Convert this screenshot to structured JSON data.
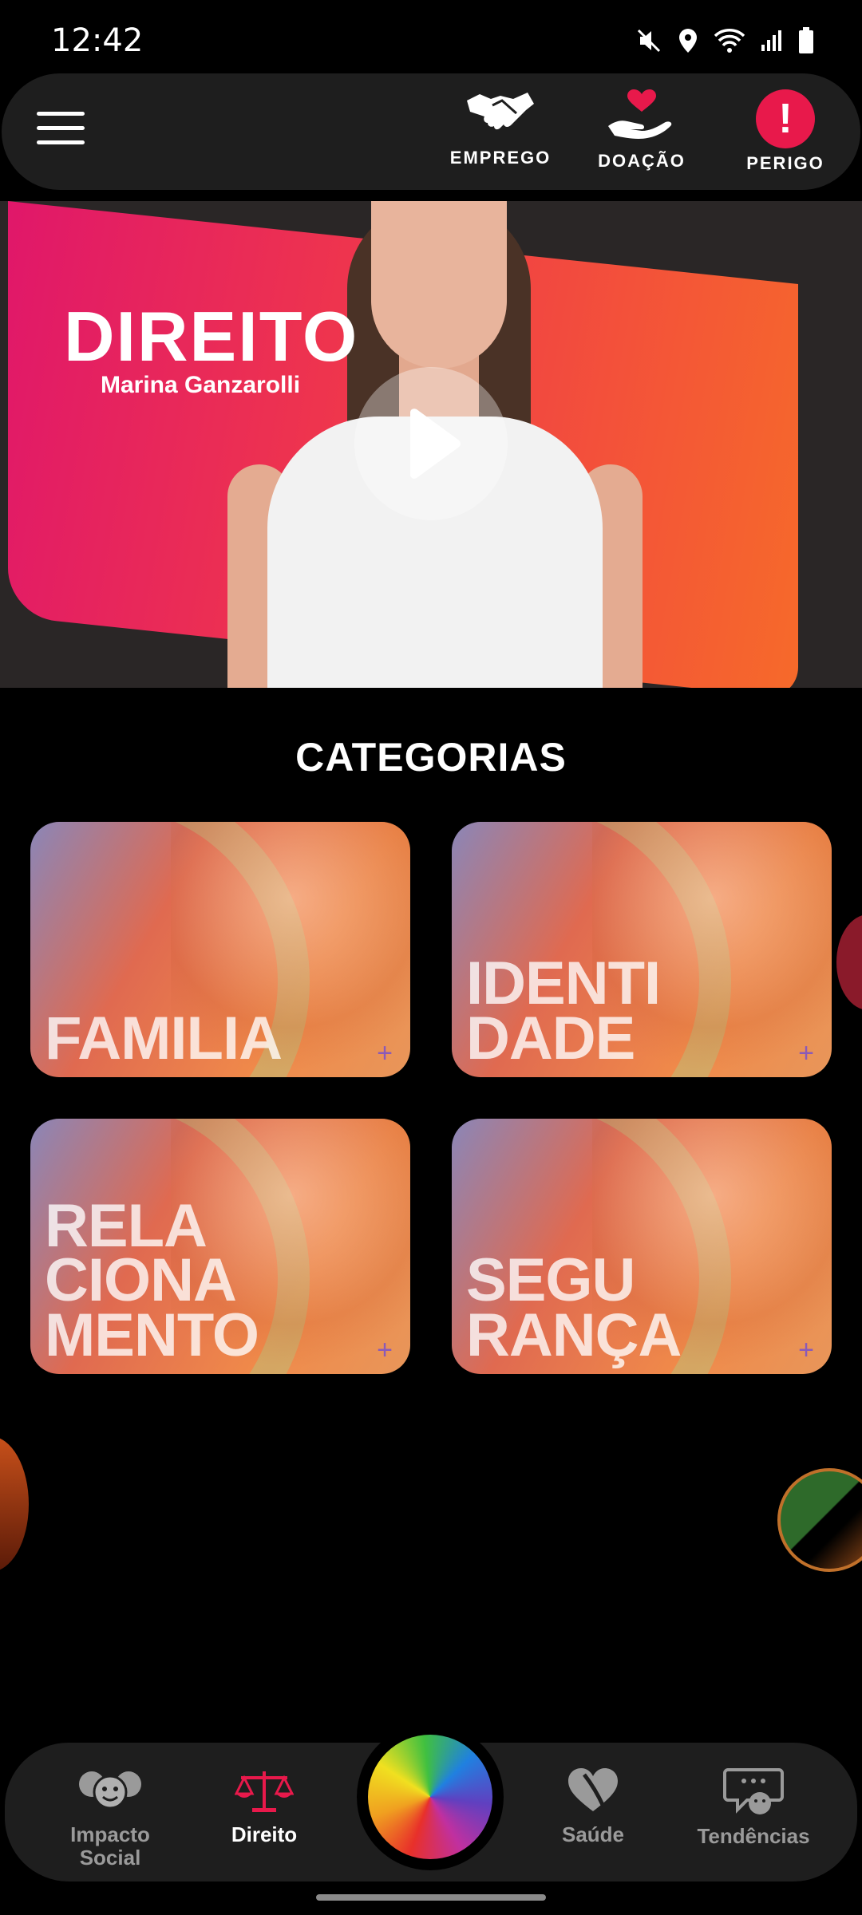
{
  "status": {
    "time": "12:42"
  },
  "top_bar": {
    "actions": [
      {
        "label": "EMPREGO",
        "icon": "handshake-icon"
      },
      {
        "label": "DOAÇÃO",
        "icon": "donation-heart-hand-icon"
      },
      {
        "label": "PERIGO",
        "icon": "danger-alert-icon"
      }
    ]
  },
  "hero": {
    "title": "DIREITO",
    "subtitle": "Marina Ganzarolli"
  },
  "categories": {
    "title": "CATEGORIAS",
    "items": [
      {
        "label": "FAMILIA"
      },
      {
        "label": "IDENTI\nDADE"
      },
      {
        "label": "RELA\nCIONA\nMENTO"
      },
      {
        "label": "SEGU\nRANÇA"
      }
    ]
  },
  "bottom_nav": {
    "items": [
      {
        "label": "Impacto\nSocial",
        "icon": "social-impact-faces-icon"
      },
      {
        "label": "Direito",
        "icon": "scales-icon",
        "active": true
      },
      {
        "label": "Saúde",
        "icon": "health-heart-icon"
      },
      {
        "label": "Tendências",
        "icon": "chat-bubble-icon"
      }
    ]
  },
  "colors": {
    "accent": "#e8194b",
    "background": "#000000",
    "bar": "#1e1e1e"
  }
}
